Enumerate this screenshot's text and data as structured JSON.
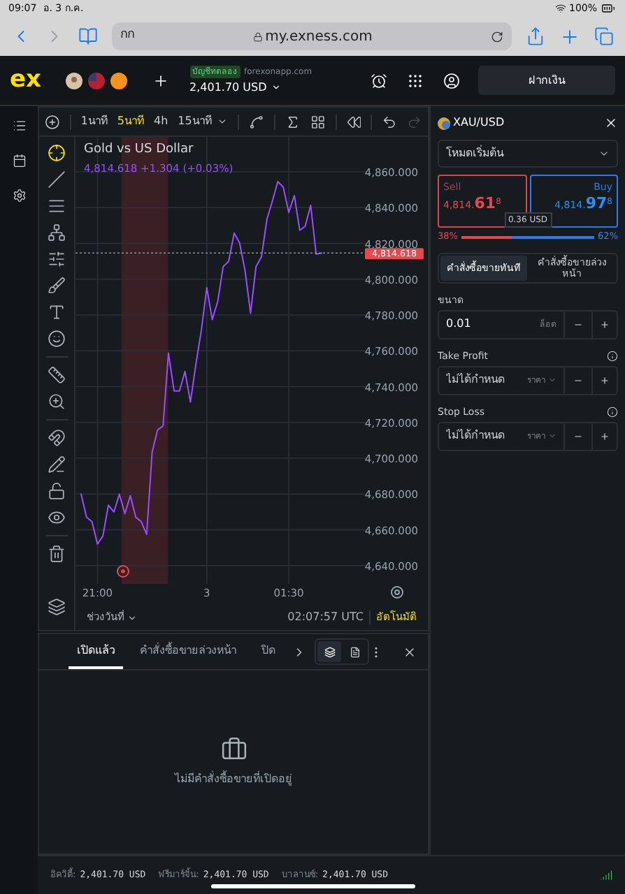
{
  "status_bar": {
    "time": "09:07",
    "date": "อ. 3 ก.ค.",
    "battery": "100%"
  },
  "browser": {
    "text_size": "กก",
    "url": "my.exness.com"
  },
  "header": {
    "logo": "ex",
    "account_badge": "บัญชีทดลอง",
    "server": "forexonapp.com",
    "balance": "2,401.70 USD",
    "deposit_button": "ฝากเงิน"
  },
  "chart": {
    "timeframes": [
      {
        "label": "1นาที",
        "selected": false
      },
      {
        "label": "5นาที",
        "selected": true
      },
      {
        "label": "4h",
        "selected": false
      },
      {
        "label": "15นาที",
        "selected": false
      }
    ],
    "redo_disabled": true,
    "quote": "4,814.618 +1.304 (+0.03%)",
    "chart_data": {
      "type": "line",
      "grid": true,
      "categories": [
        null,
        null,
        null,
        "21:00",
        null,
        null,
        null,
        null,
        null,
        null,
        null,
        null,
        null,
        null,
        null,
        null,
        null,
        null,
        null,
        null,
        null,
        null,
        null,
        "3",
        null,
        null,
        null,
        null,
        null,
        null,
        null,
        null,
        null,
        null,
        null,
        null,
        null,
        null,
        "01:30",
        null,
        null,
        null,
        null,
        null,
        null
      ],
      "ylim": [
        4629.8,
        4879.5
      ],
      "yticks": [
        {
          "value": 4860,
          "label": "4,860.000"
        },
        {
          "value": 4840,
          "label": "4,840.000"
        },
        {
          "value": 4820,
          "label": "4,820.000"
        },
        {
          "value": 4800,
          "label": "4,800.000"
        },
        {
          "value": 4780,
          "label": "4,780.000"
        },
        {
          "value": 4760,
          "label": "4,760.000"
        },
        {
          "value": 4740,
          "label": "4,740.000"
        },
        {
          "value": 4720,
          "label": "4,720.000"
        },
        {
          "value": 4700,
          "label": "4,700.000"
        },
        {
          "value": 4680,
          "label": "4,680.000"
        },
        {
          "value": 4660,
          "label": "4,660.000"
        },
        {
          "value": 4640,
          "label": "4,640.000"
        }
      ],
      "series": [
        {
          "name": "Gold vs US Dollar",
          "color": "#9b4dff",
          "values": [
            4680,
            4667,
            4664.5,
            4652,
            4656.6,
            4673.7,
            4670,
            4680,
            4669,
            4679,
            4667,
            4664.6,
            4657.4,
            4703.3,
            4715.8,
            4718,
            4758.7,
            4737.6,
            4737.6,
            4748.5,
            4731.4,
            4752.5,
            4771.5,
            4795.3,
            4777.4,
            4787.5,
            4807,
            4810,
            4825.7,
            4820.2,
            4804.6,
            4781,
            4807,
            4812.5,
            4833.5,
            4843.6,
            4854.5,
            4851.4,
            4837.4,
            4846.7,
            4827.3,
            4829.6,
            4841.3,
            4814,
            4814.6
          ]
        }
      ],
      "ref_lines": [
        {
          "axis": "y",
          "value": 4814.618,
          "label": "4,814.618",
          "color": "#8a929b"
        }
      ]
    },
    "date_range": "ช่วงวันที่",
    "clock": "02:07:57 UTC",
    "scale_mode": "อัตโนมัติ"
  },
  "order_panel": {
    "symbol": "XAU/USD",
    "mode": "โหมดเริ่มต้น",
    "sell": {
      "label": "Sell",
      "price": "4,814.",
      "big": "61",
      "small": "8"
    },
    "buy": {
      "label": "Buy",
      "price": "4,814.",
      "big": "97",
      "small": "8"
    },
    "spread": "0.36 USD",
    "sell_share": "38%",
    "buy_share": "62%",
    "level": 0.38,
    "order_types": [
      {
        "label": "คำสั่งซื้อขายทันที",
        "selected": true
      },
      {
        "label": "คำสั่งซื้อขายล่วงหน้า",
        "selected": false
      }
    ],
    "fields": [
      {
        "label": "ขนาด",
        "value": "0.01",
        "unit": "ล็อต",
        "dropdown": false,
        "info": false
      },
      {
        "label": "Take Profit",
        "placeholder": "ไม่ได้กำหนด",
        "unit": "ราคา",
        "dropdown": true,
        "info": true
      },
      {
        "label": "Stop Loss",
        "placeholder": "ไม่ได้กำหนด",
        "unit": "ราคา",
        "dropdown": true,
        "info": true
      }
    ]
  },
  "trades": {
    "tabs": [
      {
        "label": "เปิดแล้ว",
        "selected": true
      },
      {
        "label": "คำสั่งซื้อขายล่วงหน้า",
        "selected": false
      },
      {
        "label": "ปิด",
        "selected": false
      }
    ],
    "empty_message": "ไม่มีคำสั่งซื้อขายที่เปิดอยู่"
  },
  "account_summary": [
    {
      "label": "อิควิตี้:",
      "value": "2,401.70 USD"
    },
    {
      "label": "ฟรีมาร์จิ้น:",
      "value": "2,401.70 USD"
    },
    {
      "label": "บาลานซ์:",
      "value": "2,401.70 USD"
    }
  ]
}
